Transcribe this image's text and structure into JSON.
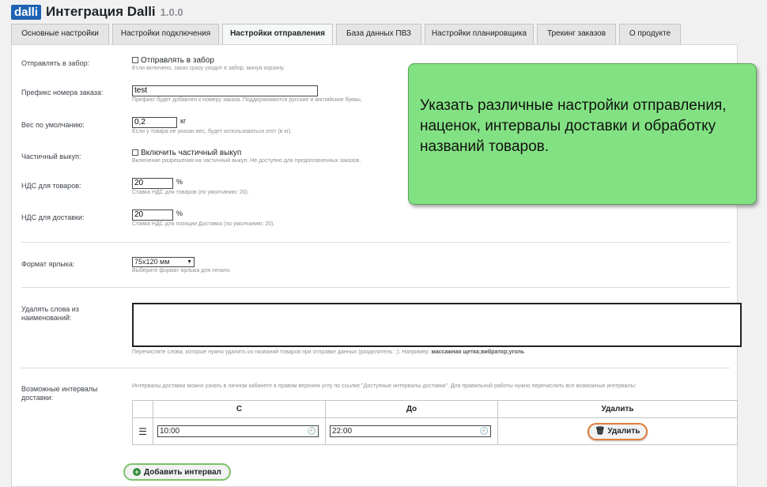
{
  "header": {
    "logo": "dalli",
    "title": "Интеграция Dalli",
    "version": "1.0.0"
  },
  "tabs": [
    {
      "label": "Основные настройки",
      "active": false
    },
    {
      "label": "Настройки подключения",
      "active": false
    },
    {
      "label": "Настройки отправления",
      "active": true
    },
    {
      "label": "База данных ПВЗ",
      "active": false
    },
    {
      "label": "Настройки планировщика",
      "active": false
    },
    {
      "label": "Трекинг заказов",
      "active": false
    },
    {
      "label": "О продукте",
      "active": false
    }
  ],
  "form": {
    "send_to_pickup": {
      "label": "Отправлять в забор:",
      "checkbox_label": "Отправлять в забор",
      "checked": false,
      "desc": "Если включено, заказ сразу уходит в забор, минуя корзину."
    },
    "order_prefix": {
      "label": "Префикс номера заказа:",
      "value": "test",
      "desc": "Префикс будет добавлен к номеру заказа. Поддерживаются русские и английские буквы,"
    },
    "default_weight": {
      "label": "Вес по умолчанию:",
      "value": "0,2",
      "unit": "кг",
      "desc": "Если у товара не указан вес, будет использоваться этот (в кг)."
    },
    "partial_buyout": {
      "label": "Частичный выкуп:",
      "checkbox_label": "Включить частичный выкуп",
      "checked": false,
      "desc": "Включение разрешения на частичный выкуп. Не доступно для предоплаченных заказов."
    },
    "vat_goods": {
      "label": "НДС для товаров:",
      "value": "20",
      "unit": "%",
      "desc": "Ставка НДС для товаров (по умолчанию: 20)."
    },
    "vat_delivery": {
      "label": "НДС для доставки:",
      "value": "20",
      "unit": "%",
      "desc": "Ставка НДС для позиции Доставка (по умолчанию: 20)."
    },
    "label_format": {
      "label": "Формат ярлыка:",
      "value": "75x120 мм",
      "desc": "Выберите формат ярлыка для печати."
    },
    "remove_words": {
      "label": "Удалять слова из наименований:",
      "value": "",
      "desc": "Перечислите слова, которые нужно удалить из названий товаров при отправке данных (разделитель: ;). Например:",
      "example": "массажная щетка;вибратор;уголь"
    },
    "intervals": {
      "label": "Возможные интервалы доставки:",
      "desc": "Интервалы доставки можно узнать в личном кабинете в правом верхнем углу по ссылке \"Доступные интервалы доставки\". Для правильной работы нужно перечислить все возможные интервалы:",
      "columns": {
        "from": "С",
        "to": "До",
        "delete": "Удалить"
      },
      "rows": [
        {
          "from": "10:00",
          "to": "22:00",
          "delete_label": "Удалить"
        }
      ],
      "add_label": "Добавить интервал"
    }
  },
  "callout": {
    "text": "Указать различные настройки отправления, наценок, интервалы доставки и обработку названий товаров."
  },
  "colors": {
    "accent": "#1e63b4",
    "callout": "#82e182",
    "delete_border": "#e37c3a",
    "add_border": "#7ac36a"
  },
  "icons": {
    "checkbox": "checkbox-icon",
    "clock": "clock-icon",
    "trash": "trash-icon",
    "plus": "plus-circle-icon",
    "handle": "drag-handle-icon",
    "chevron": "chevron-down-icon"
  }
}
